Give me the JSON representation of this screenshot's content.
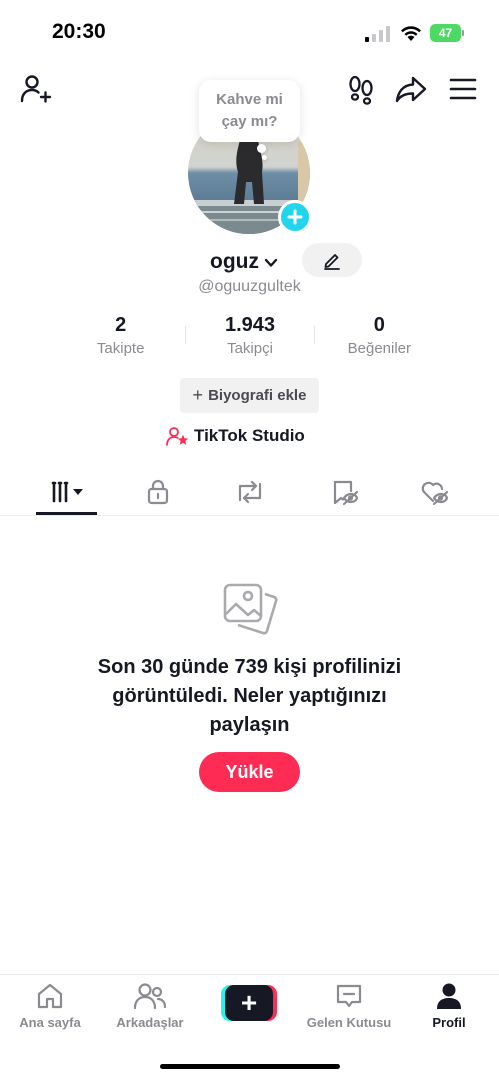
{
  "status_bar": {
    "time": "20:30",
    "battery": "47",
    "battery_color": "#4cd964"
  },
  "top_nav": {
    "icons": [
      "add-friend-icon",
      "footprints-icon",
      "share-icon",
      "menu-icon"
    ]
  },
  "profile": {
    "bubble_line1": "Kahve mi",
    "bubble_line2": "çay mı?",
    "username": "oguz",
    "handle": "@oguuzgultek",
    "stats": [
      {
        "value": "2",
        "label": "Takipte"
      },
      {
        "value": "1.943",
        "label": "Takipçi"
      },
      {
        "value": "0",
        "label": "Beğeniler"
      }
    ],
    "bio_button": "Biyografi ekle",
    "studio_label": "TikTok Studio"
  },
  "tabs": [
    "videos-grid-icon",
    "lock-icon",
    "repost-icon",
    "saved-hidden-icon",
    "liked-hidden-icon"
  ],
  "empty_state": {
    "message": "Son 30 günde 739 kişi profilinizi görüntüledi. Neler yaptığınızı paylaşın",
    "upload_button": "Yükle"
  },
  "bottom_nav": {
    "items": [
      {
        "label": "Ana sayfa",
        "icon": "home-icon"
      },
      {
        "label": "Arkadaşlar",
        "icon": "friends-icon"
      },
      {
        "label": "",
        "icon": "create-icon"
      },
      {
        "label": "Gelen Kutusu",
        "icon": "inbox-icon"
      },
      {
        "label": "Profil",
        "icon": "profile-icon"
      }
    ],
    "active": "Profil"
  },
  "colors": {
    "accent": "#fe2c55",
    "cyan": "#20d5ec",
    "text": "#161823",
    "muted": "#8a8b91"
  }
}
